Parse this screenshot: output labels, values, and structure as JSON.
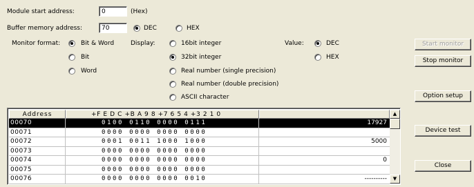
{
  "module_start": {
    "label": "Module start address:",
    "value": "0",
    "unit": "(Hex)"
  },
  "buffer_memory": {
    "label": "Buffer memory address:",
    "value": "70",
    "options": [
      {
        "label": "DEC",
        "selected": true
      },
      {
        "label": "HEX",
        "selected": false
      }
    ]
  },
  "monitor_format": {
    "label": "Monitor format:",
    "options": [
      {
        "label": "Bit & Word",
        "selected": true
      },
      {
        "label": "Bit",
        "selected": false
      },
      {
        "label": "Word",
        "selected": false
      }
    ]
  },
  "display": {
    "label": "Display:",
    "options": [
      {
        "label": "16bit integer",
        "selected": false
      },
      {
        "label": "32bit integer",
        "selected": true
      },
      {
        "label": "Real number (single precision)",
        "selected": false
      },
      {
        "label": "Real number (double precision)",
        "selected": false
      },
      {
        "label": "ASCII character",
        "selected": false
      }
    ]
  },
  "value_format": {
    "label": "Value:",
    "options": [
      {
        "label": "DEC",
        "selected": true
      },
      {
        "label": "HEX",
        "selected": false
      }
    ]
  },
  "buttons": {
    "start_monitor": "Start monitor",
    "stop_monitor": "Stop monitor",
    "option_setup": "Option setup",
    "device_test": "Device test",
    "close": "Close"
  },
  "table": {
    "headers": [
      "Address",
      "+F E D C  +B A 9 8  +7 6 5 4  +3 2 1 0",
      ""
    ],
    "rows": [
      {
        "address": "00070",
        "bits": "0100 0110 0000 0111",
        "value": "17927",
        "selected": true
      },
      {
        "address": "00071",
        "bits": "0000 0000 0000 0000",
        "value": ""
      },
      {
        "address": "00072",
        "bits": "0001 0011 1000 1000",
        "value": "5000"
      },
      {
        "address": "00073",
        "bits": "0000 0000 0000 0000",
        "value": ""
      },
      {
        "address": "00074",
        "bits": "0000 0000 0000 0000",
        "value": "0"
      },
      {
        "address": "00075",
        "bits": "0000 0000 0000 0000",
        "value": ""
      },
      {
        "address": "00076",
        "bits": "0000 0000 0000 0010",
        "value": "----------"
      }
    ]
  },
  "scrollbar": {
    "up_icon": "▲",
    "down_icon": "▼"
  }
}
